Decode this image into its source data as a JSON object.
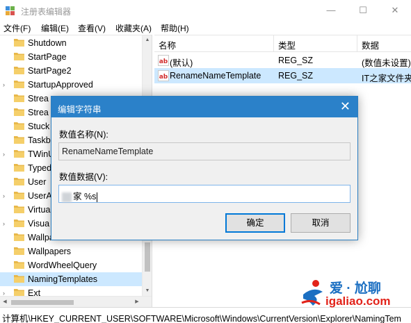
{
  "window": {
    "title": "注册表编辑器",
    "minimize_glyph": "—",
    "maximize_glyph": "☐",
    "close_glyph": "✕"
  },
  "menu": [
    "文件(F)",
    "编辑(E)",
    "查看(V)",
    "收藏夹(A)",
    "帮助(H)"
  ],
  "tree": {
    "items": [
      {
        "label": "Shutdown",
        "expander": "",
        "selected": false
      },
      {
        "label": "StartPage",
        "expander": "",
        "selected": false
      },
      {
        "label": "StartPage2",
        "expander": "",
        "selected": false
      },
      {
        "label": "StartupApproved",
        "expander": "›",
        "selected": false
      },
      {
        "label": "Strea",
        "expander": "",
        "selected": false
      },
      {
        "label": "Strea",
        "expander": "",
        "selected": false
      },
      {
        "label": "Stuck",
        "expander": "",
        "selected": false
      },
      {
        "label": "Taskb",
        "expander": "",
        "selected": false
      },
      {
        "label": "TWinU",
        "expander": "›",
        "selected": false
      },
      {
        "label": "Typed",
        "expander": "",
        "selected": false
      },
      {
        "label": "User",
        "expander": "",
        "selected": false
      },
      {
        "label": "UserA",
        "expander": "›",
        "selected": false
      },
      {
        "label": "Virtua",
        "expander": "",
        "selected": false
      },
      {
        "label": "Visua",
        "expander": "›",
        "selected": false
      },
      {
        "label": "Wallpa",
        "expander": "",
        "selected": false
      },
      {
        "label": "Wallpapers",
        "expander": "",
        "selected": false
      },
      {
        "label": "WordWheelQuery",
        "expander": "",
        "selected": false
      },
      {
        "label": "NamingTemplates",
        "expander": "",
        "selected": true
      },
      {
        "label": "Ext",
        "expander": "›",
        "selected": false
      }
    ]
  },
  "list": {
    "columns": [
      "名称",
      "类型",
      "数据"
    ],
    "rows": [
      {
        "name": "(默认)",
        "type": "REG_SZ",
        "data": "(数值未设置)",
        "selected": false
      },
      {
        "name": "RenameNameTemplate",
        "type": "REG_SZ",
        "data": "IT之家文件夹",
        "selected": true
      }
    ]
  },
  "status_bar": "计算机\\HKEY_CURRENT_USER\\SOFTWARE\\Microsoft\\Windows\\CurrentVersion\\Explorer\\NamingTem",
  "dialog": {
    "title": "编辑字符串",
    "close_glyph": "✕",
    "name_label": "数值名称(N):",
    "name_value": "RenameNameTemplate",
    "data_label": "数值数据(V):",
    "data_value": "家 %s",
    "ok_label": "确定",
    "cancel_label": "取消"
  },
  "watermark": {
    "brand": "爱 · 尬聊",
    "url": "igaliao.com"
  },
  "colors": {
    "dialog_title_bg": "#2b81c9",
    "selection_bg": "#cce8ff",
    "folder": "#e8b84a",
    "watermark_accent": "#e2231a"
  }
}
